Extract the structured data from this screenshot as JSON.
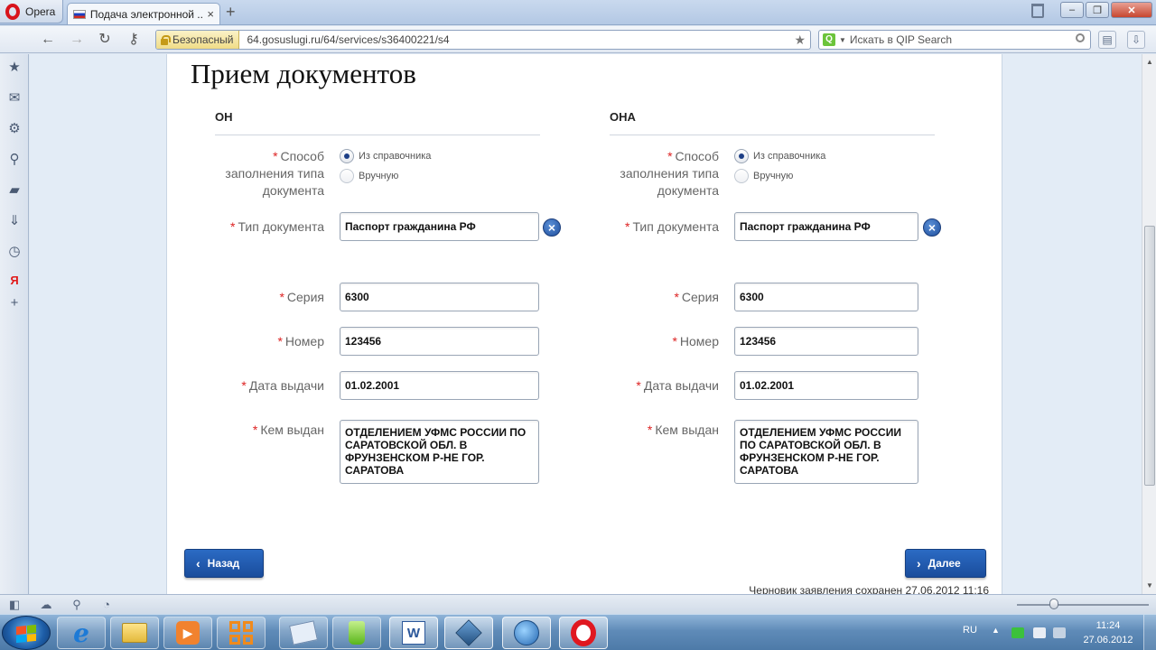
{
  "browser": {
    "menu_label": "Opera",
    "tab_title": "Подача электронной ...",
    "tab_close": "×",
    "new_tab": "+",
    "security_badge": "Безопасный",
    "url": "64.gosuslugi.ru/64/services/s36400221/s4",
    "search_placeholder": "Искать в QIP Search",
    "window_controls": {
      "minimize": "–",
      "restore": "❐",
      "close": "✕"
    }
  },
  "side_panel": {
    "icons": [
      "star-icon",
      "mail-icon",
      "gear-icon",
      "share-icon",
      "note-icon",
      "download-icon",
      "history-icon",
      "yandex-icon",
      "plus-icon"
    ],
    "yandex_glyph": "Я"
  },
  "page": {
    "title": "Прием документов",
    "required_mark": "*",
    "columns": [
      {
        "heading": "ОН",
        "fill_method_label": "Способ заполнения типа документа",
        "fill_options": [
          "Из справочника",
          "Вручную"
        ],
        "doc_type_label": "Тип документа",
        "doc_type_value": "Паспорт гражданина РФ",
        "series_label": "Серия",
        "series_value": "6300",
        "number_label": "Номер",
        "number_value": "123456",
        "issue_date_label": "Дата выдачи",
        "issue_date_value": "01.02.2001",
        "issued_by_label": "Кем выдан",
        "issued_by_value": "ОТДЕЛЕНИЕМ УФМС РОССИИ ПО САРАТОВСКОЙ ОБЛ. В ФРУНЗЕНСКОМ Р-НЕ ГОР. САРАТОВА"
      },
      {
        "heading": "ОНА",
        "fill_method_label": "Способ заполнения типа документа",
        "fill_options": [
          "Из справочника",
          "Вручную"
        ],
        "doc_type_label": "Тип документа",
        "doc_type_value": "Паспорт гражданина РФ",
        "series_label": "Серия",
        "series_value": "6300",
        "number_label": "Номер",
        "number_value": "123456",
        "issue_date_label": "Дата выдачи",
        "issue_date_value": "01.02.2001",
        "issued_by_label": "Кем выдан",
        "issued_by_value": "ОТДЕЛЕНИЕМ УФМС РОССИИ ПО САРАТОВСКОЙ ОБЛ. В ФРУНЗЕНСКОМ Р-НЕ ГОР. САРАТОВА"
      }
    ],
    "clear_glyph": "×",
    "back_label": "Назад",
    "next_label": "Далее",
    "draft_note": "Черновик заявления сохранен 27.06.2012 11:16"
  },
  "taskbar": {
    "language": "RU",
    "time": "11:24",
    "date": "27.06.2012",
    "apps": [
      "internet-explorer-icon",
      "file-explorer-icon",
      "media-player-icon",
      "office-tiles-icon",
      "notes-icon",
      "green-app-icon",
      "word-icon",
      "virtualbox-icon",
      "thunderbird-icon",
      "opera-icon"
    ],
    "word_glyph": "W"
  },
  "colors": {
    "accent_button": "#1f55a6",
    "required_star": "#dd2222",
    "opera_red": "#e01820"
  }
}
